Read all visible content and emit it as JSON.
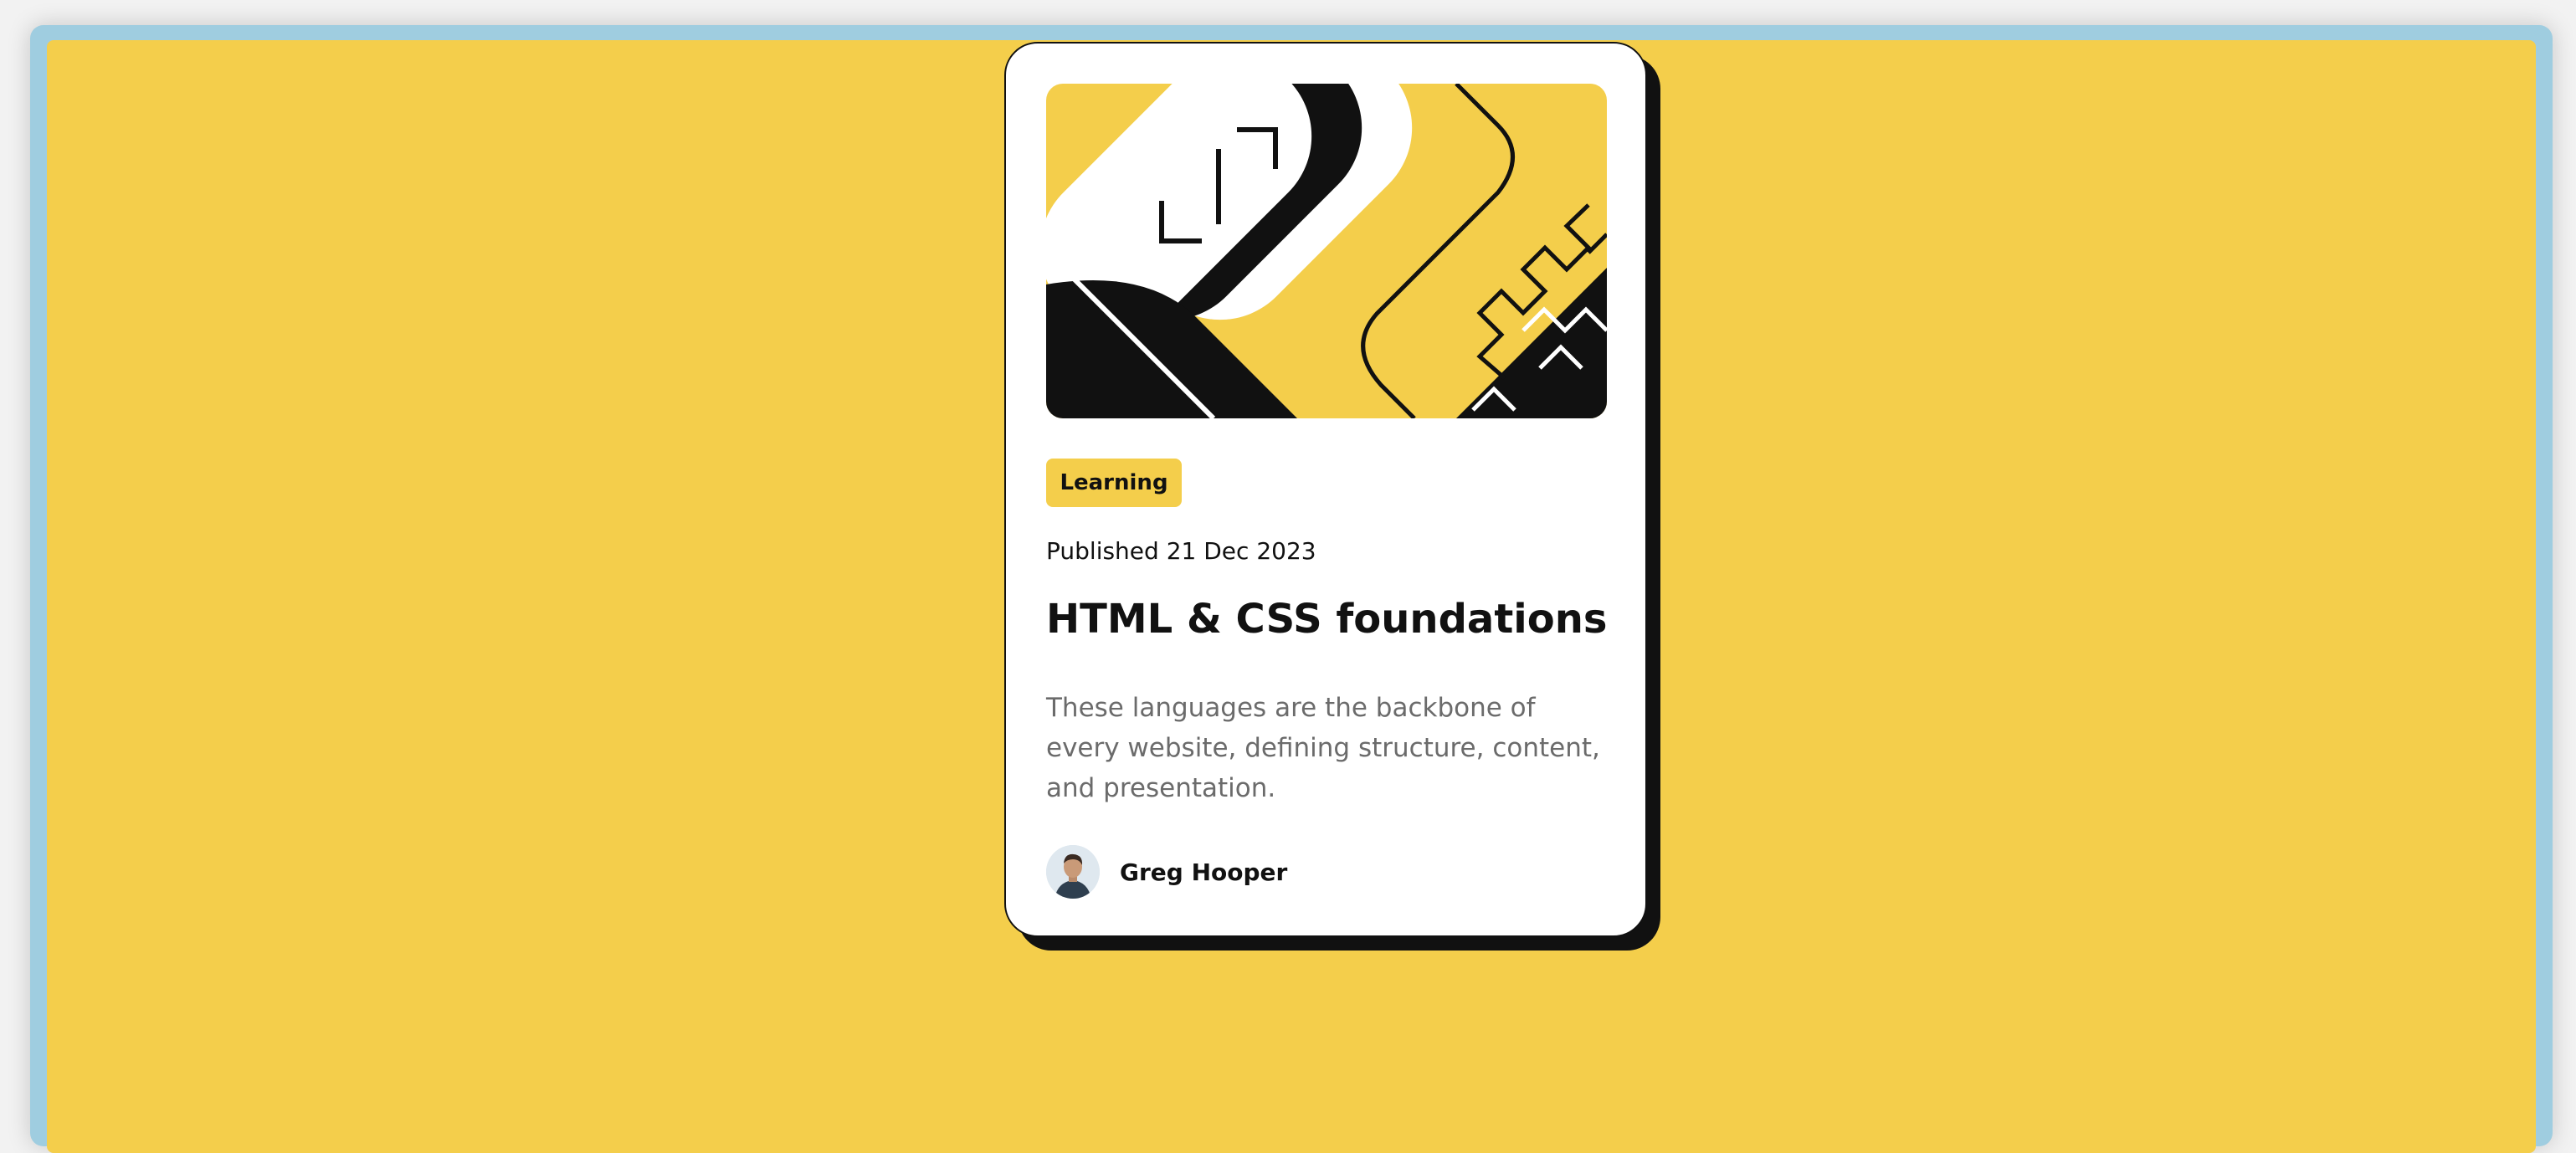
{
  "card": {
    "tag": "Learning",
    "published": "Published 21 Dec 2023",
    "title": "HTML & CSS foundations",
    "description": "These languages are the backbone of every website, defining structure, content, and presentation.",
    "author": "Greg Hooper",
    "hero_icon": "illustration-article",
    "avatar_icon": "author-avatar"
  },
  "colors": {
    "background": "#f4ce4b",
    "card": "#ffffff",
    "ink": "#111111",
    "muted_text": "#6b6b6b",
    "frame": "#9fcde0"
  }
}
